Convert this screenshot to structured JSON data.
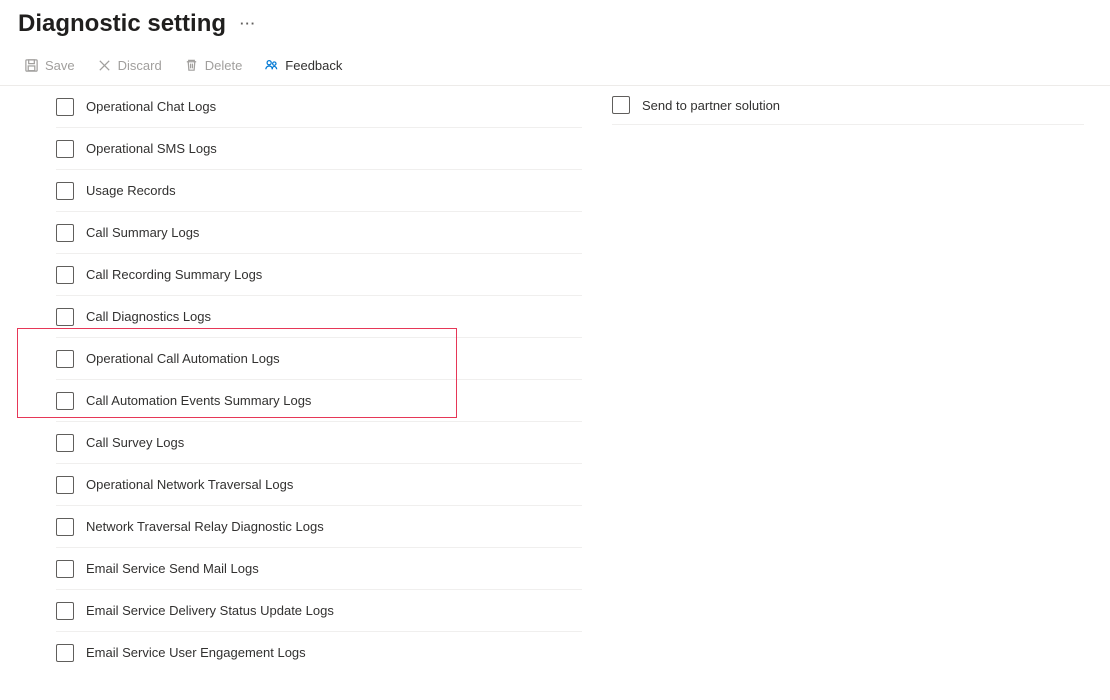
{
  "header": {
    "title": "Diagnostic setting"
  },
  "toolbar": {
    "save_label": "Save",
    "discard_label": "Discard",
    "delete_label": "Delete",
    "feedback_label": "Feedback"
  },
  "categories": [
    {
      "label": "Operational Chat Logs",
      "checked": false
    },
    {
      "label": "Operational SMS Logs",
      "checked": false
    },
    {
      "label": "Usage Records",
      "checked": false
    },
    {
      "label": "Call Summary Logs",
      "checked": false
    },
    {
      "label": "Call Recording Summary Logs",
      "checked": false
    },
    {
      "label": "Call Diagnostics Logs",
      "checked": false
    },
    {
      "label": "Operational Call Automation Logs",
      "checked": false
    },
    {
      "label": "Call Automation Events Summary Logs",
      "checked": false
    },
    {
      "label": "Call Survey Logs",
      "checked": false
    },
    {
      "label": "Operational Network Traversal Logs",
      "checked": false
    },
    {
      "label": "Network Traversal Relay Diagnostic Logs",
      "checked": false
    },
    {
      "label": "Email Service Send Mail Logs",
      "checked": false
    },
    {
      "label": "Email Service Delivery Status Update Logs",
      "checked": false
    },
    {
      "label": "Email Service User Engagement Logs",
      "checked": false
    }
  ],
  "destinations": [
    {
      "label": "Send to partner solution",
      "checked": false
    }
  ],
  "highlight": {
    "start_index": 6,
    "end_index": 7
  }
}
